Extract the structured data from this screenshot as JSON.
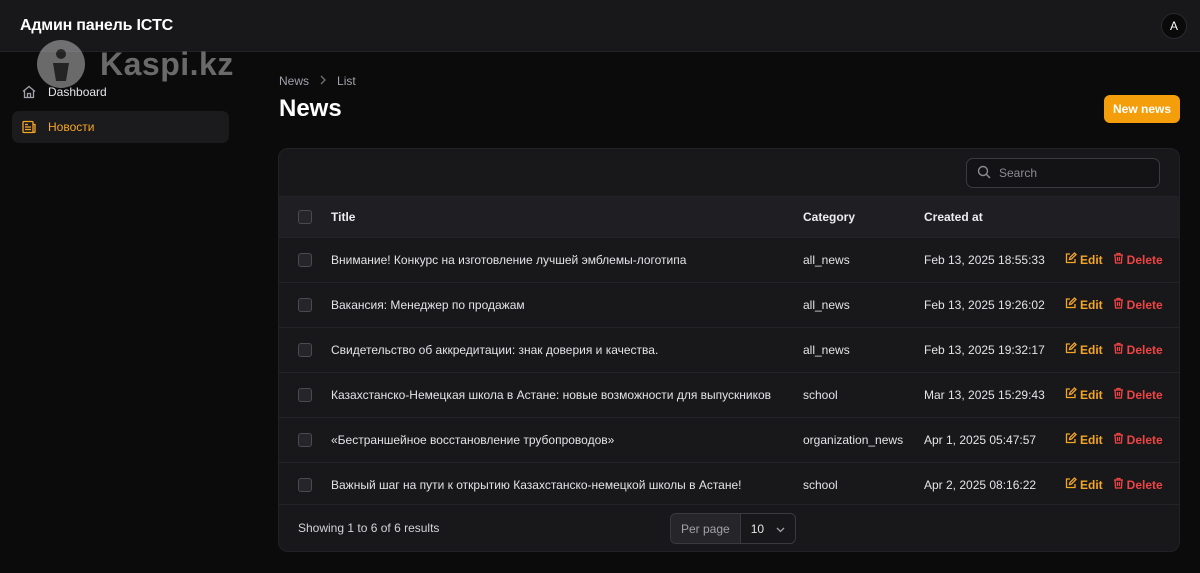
{
  "topbar": {
    "brand": "Админ панель ICTC",
    "avatar_initial": "A"
  },
  "watermark": {
    "text": "Kaspi.kz"
  },
  "sidebar": {
    "items": [
      {
        "label": "Dashboard",
        "icon": "home-icon",
        "active": false
      },
      {
        "label": "Новости",
        "icon": "newspaper-icon",
        "active": true
      }
    ]
  },
  "breadcrumb": {
    "items": [
      "News",
      "List"
    ]
  },
  "page": {
    "title": "News",
    "new_button": "New news"
  },
  "search": {
    "placeholder": "Search"
  },
  "table": {
    "columns": [
      "Title",
      "Category",
      "Created at"
    ],
    "edit_label": "Edit",
    "delete_label": "Delete",
    "rows": [
      {
        "title": "Внимание! Конкурс на изготовление лучшей эмблемы-логотипа",
        "category": "all_news",
        "created": "Feb 13, 2025 18:55:33"
      },
      {
        "title": "Вакансия: Менеджер по продажам",
        "category": "all_news",
        "created": "Feb 13, 2025 19:26:02"
      },
      {
        "title": "Свидетельство об аккредитации: знак доверия и качества.",
        "category": "all_news",
        "created": "Feb 13, 2025 19:32:17"
      },
      {
        "title": "Казахстанско-Немецкая школа в Астане: новые возможности для выпускников",
        "category": "school",
        "created": "Mar 13, 2025 15:29:43"
      },
      {
        "title": "«Бестраншейное восстановление трубопроводов»",
        "category": "organization_news",
        "created": "Apr 1, 2025 05:47:57"
      },
      {
        "title": "Важный шаг на пути к открытию Казахстанско-немецкой школы в Астане!",
        "category": "school",
        "created": "Apr 2, 2025 08:16:22"
      }
    ]
  },
  "footer": {
    "showing": "Showing 1 to 6 of 6 results",
    "per_page_label": "Per page",
    "per_page_value": "10"
  },
  "colors": {
    "accent": "#f59e0b",
    "danger": "#ef4444",
    "background": "#0b0b0c",
    "surface": "#18181b"
  }
}
